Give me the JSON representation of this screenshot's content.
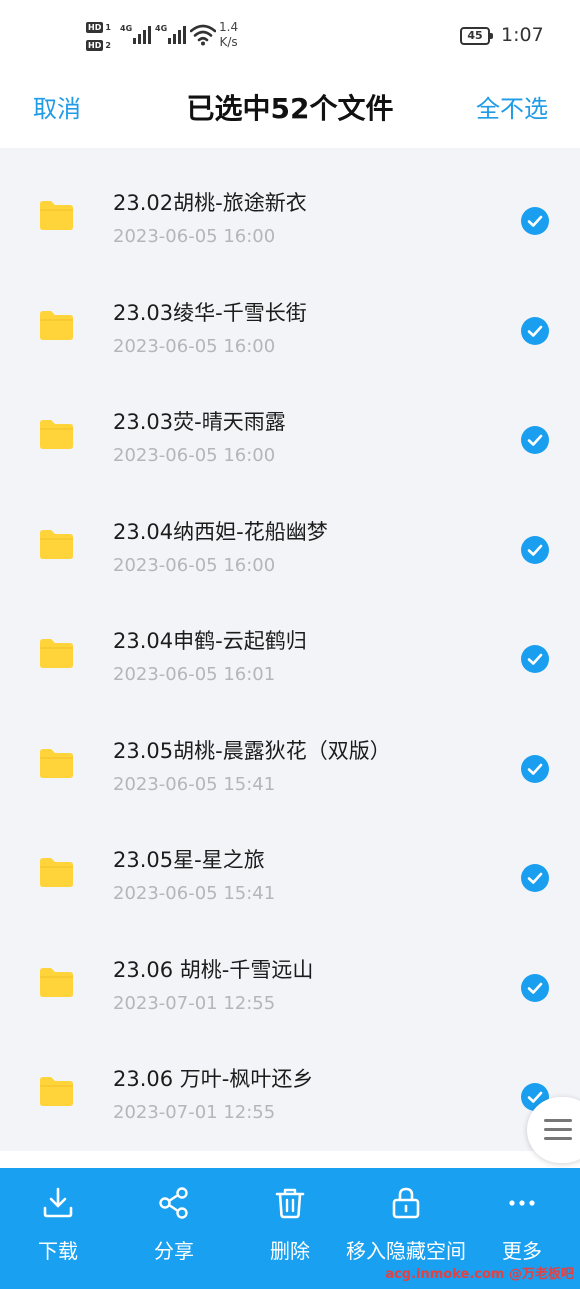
{
  "status_bar": {
    "sim1_tag": "HD",
    "sim1_num": "1",
    "sim2_tag": "HD",
    "sim2_num": "2",
    "net1": "4G",
    "net2": "4G",
    "net_speed_value": "1.4",
    "net_speed_unit": "K/s",
    "battery": "45",
    "time": "1:07"
  },
  "header": {
    "cancel_label": "取消",
    "title": "已选中52个文件",
    "deselect_all_label": "全不选"
  },
  "files": [
    {
      "name": "23.02胡桃-旅途新衣",
      "date": "2023-06-05  16:00",
      "selected": true
    },
    {
      "name": "23.03绫华-千雪长街",
      "date": "2023-06-05  16:00",
      "selected": true
    },
    {
      "name": "23.03荧-晴天雨露",
      "date": "2023-06-05  16:00",
      "selected": true
    },
    {
      "name": "23.04纳西妲-花船幽梦",
      "date": "2023-06-05  16:00",
      "selected": true
    },
    {
      "name": "23.04申鹤-云起鹤归",
      "date": "2023-06-05  16:01",
      "selected": true
    },
    {
      "name": "23.05胡桃-晨露狄花（双版）",
      "date": "2023-06-05  15:41",
      "selected": true
    },
    {
      "name": "23.05星-星之旅",
      "date": "2023-06-05  15:41",
      "selected": true
    },
    {
      "name": "23.06 胡桃-千雪远山",
      "date": "2023-07-01  12:55",
      "selected": true
    },
    {
      "name": "23.06 万叶-枫叶还乡",
      "date": "2023-07-01  12:55",
      "selected": true
    }
  ],
  "bottom_bar": {
    "download_label": "下载",
    "share_label": "分享",
    "delete_label": "删除",
    "move_hidden_label": "移入隐藏空间",
    "more_label": "更多"
  },
  "watermark": "acg.inmoke.com @万老板吧",
  "colors": {
    "accent": "#1f9be8",
    "bottom_bar": "#19a0f0",
    "folder": "#ffd43b",
    "check": "#1a9ff0",
    "list_bg": "#f2f4f7"
  },
  "icons": {
    "folder": "folder-icon",
    "check": "check-circle-icon",
    "download": "download-icon",
    "share": "share-icon",
    "delete": "trash-icon",
    "hide": "lock-icon",
    "more": "more-dots-icon",
    "float": "menu-lines-icon"
  }
}
